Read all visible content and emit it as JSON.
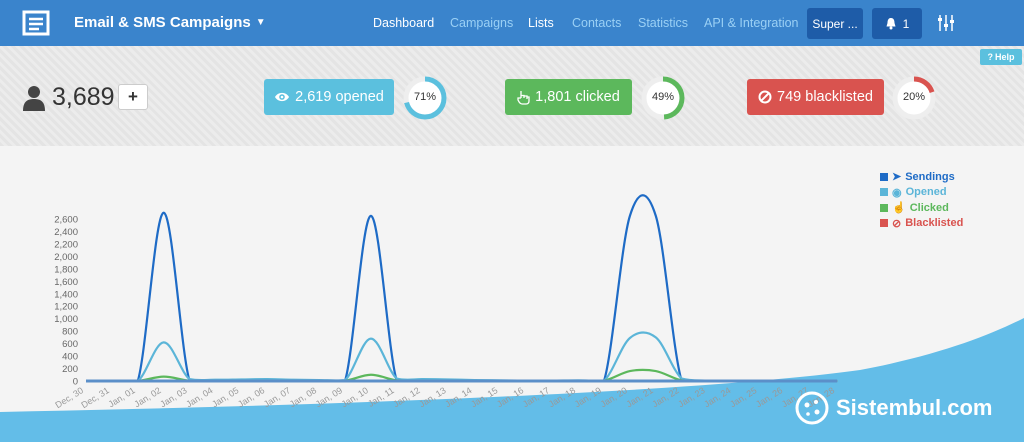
{
  "header": {
    "brand_title": "Email & SMS Campaigns",
    "brand_icon": "envelope-logo-icon",
    "nav": [
      {
        "label": "Dashboard",
        "active": true
      },
      {
        "label": "Campaigns",
        "active": false
      },
      {
        "label": "Lists",
        "active": true
      },
      {
        "label": "Contacts",
        "active": false
      },
      {
        "label": "Statistics",
        "active": false
      },
      {
        "label": "API & Integration",
        "active": false
      }
    ],
    "user_button": "Super ...",
    "notifications_count": "1",
    "settings_icon": "sliders-icon"
  },
  "stats": {
    "help_label": "Help",
    "contacts_count": "3,689",
    "add_label": "+",
    "opened": {
      "label": "2,619 opened",
      "percent_label": "71%",
      "percent": 71,
      "color": "#5bc0de"
    },
    "clicked": {
      "label": "1,801 clicked",
      "percent_label": "49%",
      "percent": 49,
      "color": "#5cb85c"
    },
    "blacklisted": {
      "label": "749 blacklisted",
      "percent_label": "20%",
      "percent": 20,
      "color": "#d9534f"
    }
  },
  "chart_data": {
    "type": "line",
    "x": [
      "Dec, 30",
      "Dec, 31",
      "Jan, 01",
      "Jan, 02",
      "Jan, 03",
      "Jan, 04",
      "Jan, 05",
      "Jan, 06",
      "Jan, 07",
      "Jan, 08",
      "Jan, 09",
      "Jan, 10",
      "Jan, 11",
      "Jan, 12",
      "Jan, 13",
      "Jan, 14",
      "Jan, 15",
      "Jan, 16",
      "Jan, 17",
      "Jan, 18",
      "Jan, 19",
      "Jan, 20",
      "Jan, 21",
      "Jan, 22",
      "Jan, 23",
      "Jan, 24",
      "Jan, 25",
      "Jan, 26",
      "Jan, 27",
      "Jan, 28"
    ],
    "y_ticks": [
      "0",
      "200",
      "400",
      "600",
      "800",
      "1,000",
      "1,200",
      "1,400",
      "1,600",
      "1,800",
      "2,000",
      "2,200",
      "2,400",
      "2,600"
    ],
    "ylim": [
      0,
      2600
    ],
    "series": [
      {
        "name": "Sendings",
        "color": "#1e6bc6",
        "icon": "paper-plane-icon",
        "values": [
          0,
          0,
          0,
          2700,
          0,
          0,
          0,
          0,
          0,
          0,
          0,
          2650,
          0,
          0,
          0,
          0,
          0,
          0,
          0,
          0,
          0,
          2650,
          2650,
          0,
          0,
          0,
          0,
          0,
          0,
          0
        ]
      },
      {
        "name": "Opened",
        "color": "#5bb5d8",
        "icon": "eye-icon",
        "values": [
          0,
          0,
          0,
          620,
          30,
          20,
          25,
          30,
          20,
          15,
          15,
          680,
          40,
          30,
          25,
          15,
          10,
          5,
          5,
          10,
          5,
          690,
          700,
          40,
          5,
          0,
          0,
          0,
          0,
          0
        ]
      },
      {
        "name": "Clicked",
        "color": "#5cb85c",
        "icon": "hand-pointer-icon",
        "values": [
          0,
          0,
          0,
          70,
          5,
          5,
          5,
          5,
          5,
          5,
          5,
          100,
          10,
          5,
          5,
          5,
          5,
          5,
          5,
          5,
          5,
          160,
          160,
          10,
          0,
          0,
          0,
          0,
          0,
          0
        ]
      },
      {
        "name": "Blacklisted",
        "color": "#d9534f",
        "icon": "ban-icon",
        "values": [
          0,
          0,
          0,
          5,
          0,
          0,
          0,
          0,
          0,
          0,
          0,
          5,
          0,
          0,
          0,
          0,
          0,
          0,
          0,
          0,
          0,
          5,
          5,
          0,
          0,
          0,
          0,
          0,
          0,
          0
        ]
      }
    ],
    "legend_position": "top-right",
    "grid": false
  },
  "watermark": {
    "text": "Sistembul.com"
  }
}
